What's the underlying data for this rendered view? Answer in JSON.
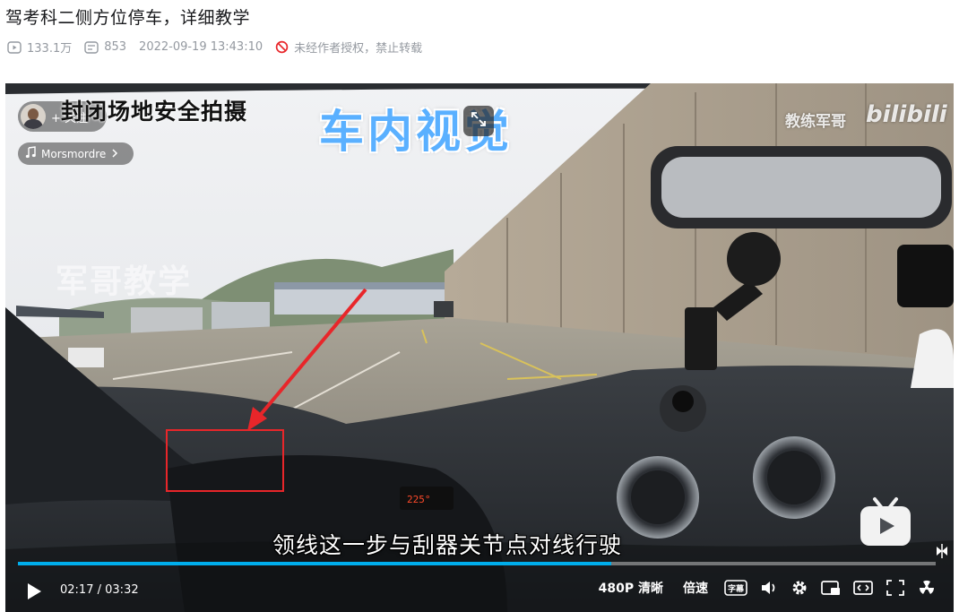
{
  "video": {
    "title": "驾考科二侧方位停车，详细教学",
    "views": "133.1万",
    "danmaku": "853",
    "date": "2022-09-19 13:43:10",
    "copyright": "未经作者授权，禁止转载"
  },
  "overlay": {
    "follow_label": "+ 关注",
    "music_label": "Morsmordre",
    "caption_top": "封闭场地安全拍摄",
    "caption_view": "车内视觉",
    "brand": "教练军哥",
    "bili_logo": "bilibili",
    "watermark": "军哥教学",
    "subtitle": "领线这一步与刮器关节点对线行驶",
    "dashboard_reading": "225°"
  },
  "player": {
    "current_time": "02:17",
    "separator": "/",
    "duration": "03:32",
    "progress": 0.646,
    "quality": "480P 清晰",
    "speed": "倍速",
    "subtitle_toggle": "字幕",
    "icons": [
      "play-icon",
      "volume-icon",
      "settings-icon",
      "pip-icon",
      "widescreen-icon",
      "fullscreen-icon",
      "radiation-icon"
    ]
  },
  "colors": {
    "accent": "#00aeec",
    "annotation": "#e8262a",
    "view_caption": "#5ab0ff"
  }
}
